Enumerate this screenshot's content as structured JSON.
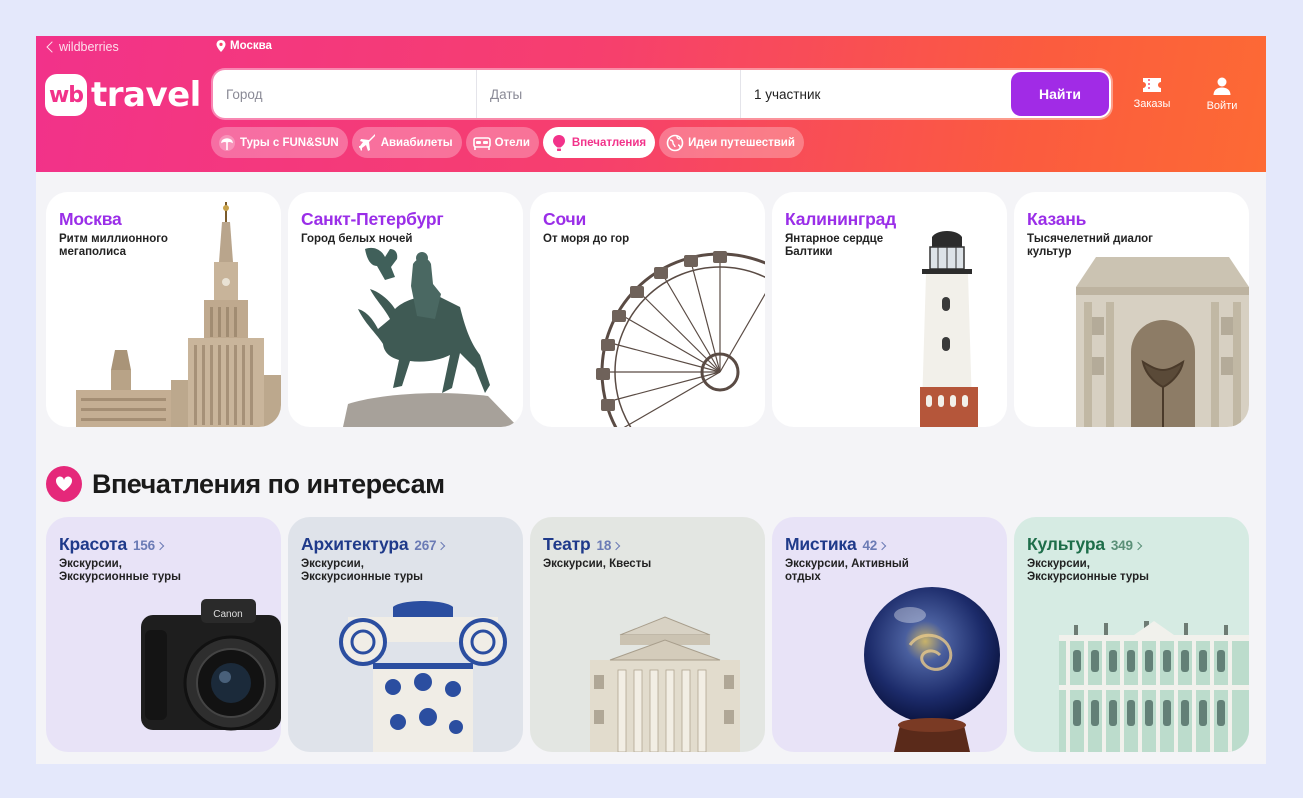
{
  "header": {
    "back_label": "wildberries",
    "location": "Москва",
    "logo_badge": "wb",
    "logo_word": "travel",
    "search": {
      "city_placeholder": "Город",
      "dates_placeholder": "Даты",
      "participants": "1 участник",
      "find_label": "Найти"
    },
    "orders_label": "Заказы",
    "login_label": "Войти"
  },
  "nav": [
    {
      "label": "Туры с FUN&SUN",
      "icon": "palm-icon"
    },
    {
      "label": "Авиабилеты",
      "icon": "plane-icon"
    },
    {
      "label": "Отели",
      "icon": "bed-icon"
    },
    {
      "label": "Впечатления",
      "icon": "balloon-icon",
      "active": true
    },
    {
      "label": "Идеи путешествий",
      "icon": "globe-icon"
    }
  ],
  "cities": [
    {
      "title": "Москва",
      "subtitle": "Ритм миллионного мегаполиса"
    },
    {
      "title": "Санкт-Петербург",
      "subtitle": "Город белых ночей"
    },
    {
      "title": "Сочи",
      "subtitle": "От моря до гор"
    },
    {
      "title": "Калининград",
      "subtitle": "Янтарное сердце Балтики"
    },
    {
      "title": "Казань",
      "subtitle": "Тысячелетний диалог культур"
    }
  ],
  "section": {
    "title": "Впечатления по интересам"
  },
  "interests": [
    {
      "title": "Красота",
      "count": "156",
      "subtitle": "Экскурсии, Экскурсионные туры",
      "bg": "#e8e3f7",
      "color": "#1f3a8a"
    },
    {
      "title": "Архитектура",
      "count": "267",
      "subtitle": "Экскурсии, Экскурсионные туры",
      "bg": "#dfe3ea",
      "color": "#1f3a8a"
    },
    {
      "title": "Театр",
      "count": "18",
      "subtitle": "Экскурсии, Квесты",
      "bg": "#e3e6e2",
      "color": "#1f3a8a"
    },
    {
      "title": "Мистика",
      "count": "42",
      "subtitle": "Экскурсии, Активный отдых",
      "bg": "#e8e3f7",
      "color": "#1f3a8a"
    },
    {
      "title": "Культура",
      "count": "349",
      "subtitle": "Экскурсии, Экскурсионные туры",
      "bg": "#d6ebe3",
      "color": "#1e6e4a"
    }
  ],
  "colors": {
    "brand_pink": "#f2328a",
    "brand_orange": "#fd6a34",
    "accent_purple": "#a12be6",
    "city_title": "#9a2ee8"
  }
}
